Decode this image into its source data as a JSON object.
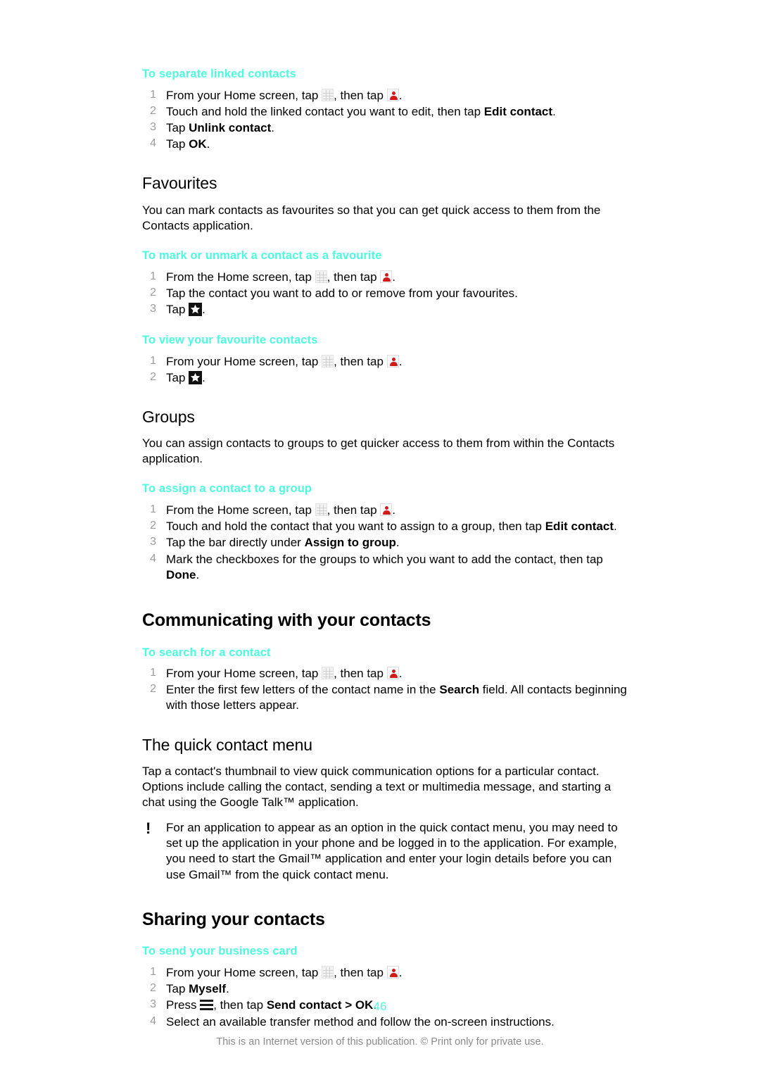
{
  "document": {
    "page_number": "46",
    "footer_note": "This is an Internet version of this publication. © Print only for private use.",
    "accent_color": "#4dfbdf",
    "step_number_color": "#9b9b9b"
  },
  "icons": {
    "app_grid": "app-grid-icon",
    "contacts": "contacts-person-icon",
    "favourite_star": "favourite-star-icon",
    "menu_key": "menu-key-icon",
    "note": "exclamation-note-icon"
  },
  "sections": {
    "separate_linked": {
      "title": "To separate linked contacts",
      "steps": {
        "s1_a": "From your Home screen, tap ",
        "s1_b": ", then tap ",
        "s1_c": ".",
        "s2_a": "Touch and hold the linked contact you want to edit, then tap ",
        "s2_bold": "Edit contact",
        "s2_b": ".",
        "s3_a": "Tap ",
        "s3_bold": "Unlink contact",
        "s3_b": ".",
        "s4_a": "Tap ",
        "s4_bold": "OK",
        "s4_b": "."
      }
    },
    "favourites": {
      "heading": "Favourites",
      "intro": "You can mark contacts as favourites so that you can get quick access to them from the Contacts application.",
      "mark_unmark": {
        "title": "To mark or unmark a contact as a favourite",
        "s1_a": "From the Home screen, tap ",
        "s1_b": ", then tap ",
        "s1_c": ".",
        "s2": "Tap the contact you want to add to or remove from your favourites.",
        "s3_a": "Tap ",
        "s3_b": "."
      },
      "view_favourites": {
        "title": "To view your favourite contacts",
        "s1_a": "From your Home screen, tap ",
        "s1_b": ", then tap ",
        "s1_c": ".",
        "s2_a": "Tap ",
        "s2_b": "."
      }
    },
    "groups": {
      "heading": "Groups",
      "intro": "You can assign contacts to groups to get quicker access to them from within the Contacts application.",
      "assign": {
        "title": "To assign a contact to a group",
        "s1_a": "From the Home screen, tap ",
        "s1_b": ", then tap ",
        "s1_c": ".",
        "s2_a": "Touch and hold the contact that you want to assign to a group, then tap ",
        "s2_bold": "Edit contact",
        "s2_b": ".",
        "s3_a": "Tap the bar directly under ",
        "s3_bold": "Assign to group",
        "s3_b": ".",
        "s4_a": "Mark the checkboxes for the groups to which you want to add the contact, then tap ",
        "s4_bold": "Done",
        "s4_b": "."
      }
    },
    "communicating": {
      "heading": "Communicating with your contacts",
      "search": {
        "title": "To search for a contact",
        "s1_a": "From your Home screen, tap ",
        "s1_b": ", then tap ",
        "s1_c": ".",
        "s2_a": "Enter the first few letters of the contact name in the ",
        "s2_bold": "Search",
        "s2_b": " field. All contacts beginning with those letters appear."
      }
    },
    "quick_contact": {
      "heading": "The quick contact menu",
      "intro": "Tap a contact's thumbnail to view quick communication options for a particular contact. Options include calling the contact, sending a text or multimedia message, and starting a chat using the Google Talk™ application.",
      "note": "For an application to appear as an option in the quick contact menu, you may need to set up the application in your phone and be logged in to the application. For example, you need to start the Gmail™ application and enter your login details before you can use Gmail™ from the quick contact menu."
    },
    "sharing": {
      "heading": "Sharing your contacts",
      "business_card": {
        "title": "To send your business card",
        "s1_a": "From your Home screen, tap ",
        "s1_b": ", then tap ",
        "s1_c": ".",
        "s2_a": "Tap ",
        "s2_bold": "Myself",
        "s2_b": ".",
        "s3_a": "Press ",
        "s3_b": ", then tap ",
        "s3_bold": "Send contact > OK",
        "s3_c": ".",
        "s4": "Select an available transfer method and follow the on-screen instructions."
      }
    }
  }
}
